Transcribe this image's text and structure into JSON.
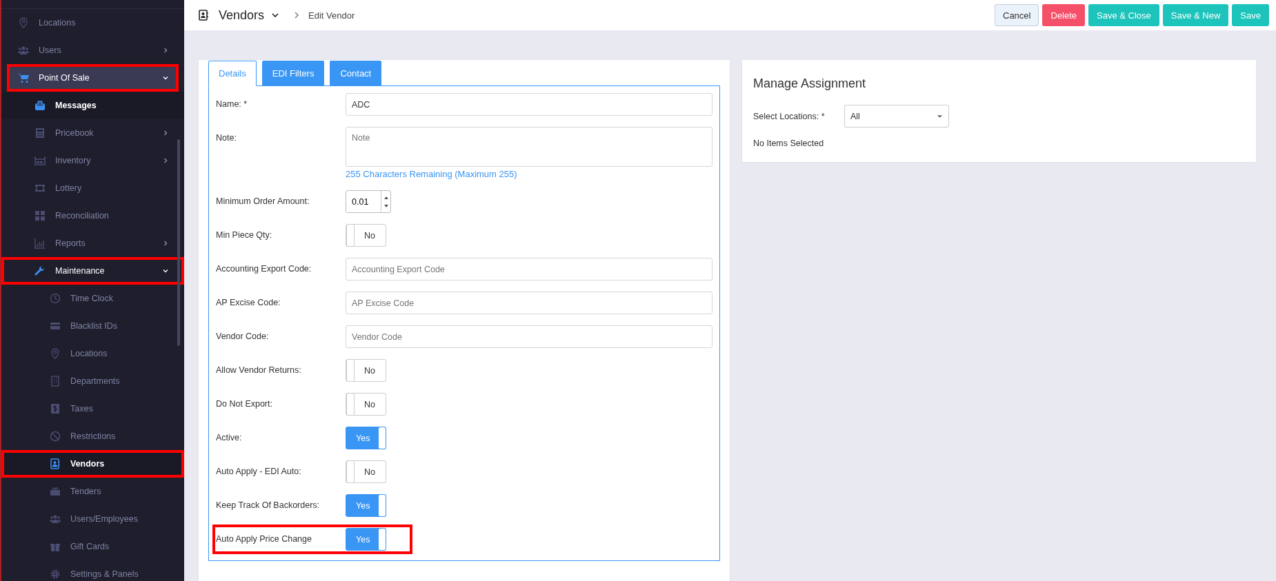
{
  "sidebar": {
    "items": [
      {
        "label": "Locations",
        "selected": false,
        "highlighted": false
      },
      {
        "label": "Users",
        "selected": false,
        "highlighted": false,
        "expanded": false
      },
      {
        "label": "Point Of Sale",
        "selected": false,
        "highlighted": true,
        "expanded": true,
        "children": [
          {
            "label": "Messages",
            "selected": true,
            "highlighted": false
          },
          {
            "label": "Pricebook",
            "selected": false,
            "highlighted": false,
            "expanded": false
          },
          {
            "label": "Inventory",
            "selected": false,
            "highlighted": false,
            "expanded": false
          },
          {
            "label": "Lottery",
            "selected": false,
            "highlighted": false
          },
          {
            "label": "Reconciliation",
            "selected": false,
            "highlighted": false
          },
          {
            "label": "Reports",
            "selected": false,
            "highlighted": false,
            "expanded": false
          },
          {
            "label": "Maintenance",
            "selected": false,
            "highlighted": true,
            "expanded": true,
            "children": [
              {
                "label": "Time Clock",
                "selected": false,
                "highlighted": false
              },
              {
                "label": "Blacklist IDs",
                "selected": false,
                "highlighted": false
              },
              {
                "label": "Locations",
                "selected": false,
                "highlighted": false
              },
              {
                "label": "Departments",
                "selected": false,
                "highlighted": false
              },
              {
                "label": "Taxes",
                "selected": false,
                "highlighted": false
              },
              {
                "label": "Restrictions",
                "selected": false,
                "highlighted": false
              },
              {
                "label": "Vendors",
                "selected": true,
                "highlighted": true
              },
              {
                "label": "Tenders",
                "selected": false,
                "highlighted": false
              },
              {
                "label": "Users/Employees",
                "selected": false,
                "highlighted": false
              },
              {
                "label": "Gift Cards",
                "selected": false,
                "highlighted": false
              },
              {
                "label": "Settings & Panels",
                "selected": false,
                "highlighted": false
              }
            ]
          }
        ]
      }
    ]
  },
  "header": {
    "title": "Vendors",
    "breadcrumb": "Edit Vendor",
    "buttons": [
      {
        "label": "Cancel",
        "kind": "light"
      },
      {
        "label": "Delete",
        "kind": "danger"
      },
      {
        "label": "Save & Close",
        "kind": "primary"
      },
      {
        "label": "Save & New",
        "kind": "primary"
      },
      {
        "label": "Save",
        "kind": "primary"
      }
    ]
  },
  "tabs": [
    {
      "label": "Details",
      "selected": true
    },
    {
      "label": "EDI Filters",
      "selected": false
    },
    {
      "label": "Contact",
      "selected": false
    }
  ],
  "form": {
    "rows": [
      {
        "kind": "text",
        "label": "Name: *",
        "value": "ADC",
        "highlighted": false
      },
      {
        "kind": "textarea",
        "label": "Note:",
        "placeholder": "Note",
        "hint": "255 Characters Remaining (Maximum 255)",
        "highlighted": false
      },
      {
        "kind": "number",
        "label": "Minimum Order Amount:",
        "value": "0.01",
        "highlighted": false
      },
      {
        "kind": "toggle",
        "label": "Min Piece Qty:",
        "on": false,
        "text": "No",
        "highlighted": false
      },
      {
        "kind": "text",
        "label": "Accounting Export Code:",
        "placeholder": "Accounting Export Code",
        "highlighted": false
      },
      {
        "kind": "text",
        "label": "AP Excise Code:",
        "placeholder": "AP Excise Code",
        "highlighted": false
      },
      {
        "kind": "text",
        "label": "Vendor Code:",
        "placeholder": "Vendor Code",
        "highlighted": false
      },
      {
        "kind": "toggle",
        "label": "Allow Vendor Returns:",
        "on": false,
        "text": "No",
        "highlighted": false
      },
      {
        "kind": "toggle",
        "label": "Do Not Export:",
        "on": false,
        "text": "No",
        "highlighted": false
      },
      {
        "kind": "toggle",
        "label": "Active:",
        "on": true,
        "text": "Yes",
        "highlighted": false
      },
      {
        "kind": "toggle",
        "label": "Auto Apply - EDI Auto:",
        "on": false,
        "text": "No",
        "highlighted": false
      },
      {
        "kind": "toggle",
        "label": "Keep Track Of Backorders:",
        "on": true,
        "text": "Yes",
        "highlighted": false
      },
      {
        "kind": "toggle",
        "label": "Auto Apply Price Change",
        "on": true,
        "text": "Yes",
        "highlighted": true
      }
    ]
  },
  "assignment": {
    "title": "Manage Assignment",
    "label": "Select Locations: *",
    "select_value": "All",
    "empty_text": "No Items Selected"
  }
}
